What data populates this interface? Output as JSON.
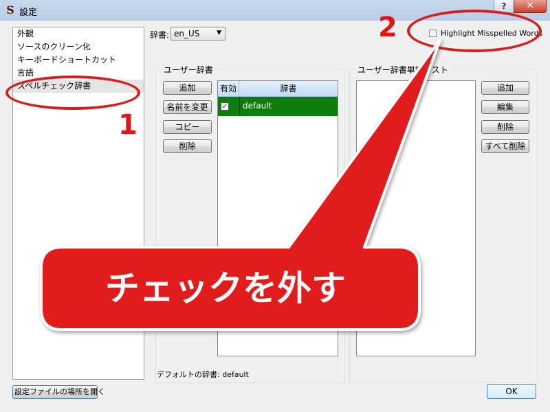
{
  "window": {
    "title": "設定",
    "icon": "app-s-icon",
    "help": "?",
    "close": "✕"
  },
  "sidebar": {
    "items": [
      {
        "label": "外観"
      },
      {
        "label": "ソースのクリーン化"
      },
      {
        "label": "キーボードショートカット"
      },
      {
        "label": "言語"
      },
      {
        "label": "スペルチェック辞書",
        "selected": true
      }
    ]
  },
  "dictionary": {
    "label": "辞書:",
    "value": "en_US"
  },
  "highlight": {
    "label": "Highlight Misspelled Words",
    "checked": false
  },
  "user_dict": {
    "title": "ユーザー辞書",
    "buttons": [
      "追加",
      "名前を変更",
      "コピー",
      "削除"
    ],
    "columns": [
      "有効",
      "辞書"
    ],
    "rows": [
      {
        "enabled": true,
        "name": "default"
      }
    ]
  },
  "word_list": {
    "title": "ユーザー辞書単語リスト",
    "buttons": [
      "追加",
      "編集",
      "削除",
      "すべて削除"
    ]
  },
  "default_dict": "デフォルトの辞書: default",
  "footer": {
    "open_settings": "設定ファイルの場所を開く",
    "ok": "OK"
  },
  "annotations": {
    "step1": "1",
    "step2": "2",
    "callout": "チェックを外す",
    "color": "#e0141a"
  }
}
